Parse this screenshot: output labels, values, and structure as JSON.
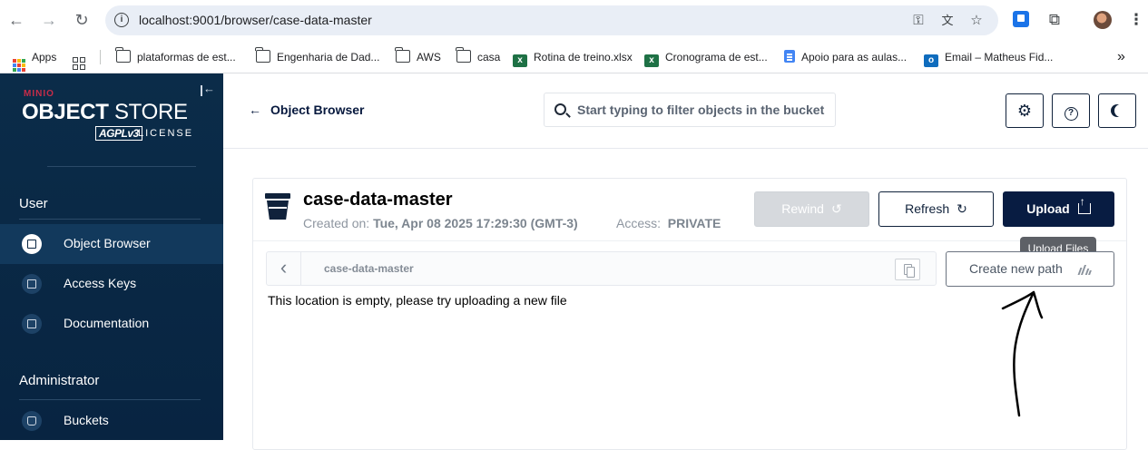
{
  "browser": {
    "url": "localhost:9001/browser/case-data-master",
    "bookmarks": [
      {
        "label": "Apps",
        "icon": "apps-grid-icon"
      },
      {
        "label": "",
        "icon": "tab-groups-icon"
      },
      {
        "label": "plataformas de est...",
        "icon": "folder-icon"
      },
      {
        "label": "Engenharia de Dad...",
        "icon": "folder-icon"
      },
      {
        "label": "AWS",
        "icon": "folder-icon"
      },
      {
        "label": "casa",
        "icon": "folder-icon"
      },
      {
        "label": "Rotina de treino.xlsx",
        "icon": "excel-icon"
      },
      {
        "label": "Cronograma de est...",
        "icon": "excel-icon"
      },
      {
        "label": "Apoio para as aulas...",
        "icon": "docs-icon"
      },
      {
        "label": "Email – Matheus Fid...",
        "icon": "outlook-icon"
      }
    ],
    "overflow_label": "»"
  },
  "sidebar": {
    "brand_small": "MINIO",
    "brand_title_bold": "OBJECT",
    "brand_title_thin": "STORE",
    "brand_badge": "AGPLv3",
    "brand_license": "LICENSE",
    "user_section": "User",
    "user_items": [
      {
        "label": "Object Browser",
        "active": true
      },
      {
        "label": "Access Keys",
        "active": false
      },
      {
        "label": "Documentation",
        "active": false
      }
    ],
    "admin_section": "Administrator",
    "admin_items": [
      {
        "label": "Buckets",
        "active": false
      }
    ]
  },
  "header": {
    "back_label": "Object Browser",
    "search_placeholder": "Start typing to filter objects in the bucket"
  },
  "bucket": {
    "name": "case-data-master",
    "created_label": "Created on:",
    "created_value": "Tue, Apr 08 2025 17:29:30 (GMT-3)",
    "access_label": "Access:",
    "access_value": "PRIVATE",
    "rewind_label": "Rewind",
    "refresh_label": "Refresh",
    "upload_label": "Upload",
    "upload_tooltip": "Upload Files",
    "breadcrumb": "case-data-master",
    "new_path_label": "Create new path",
    "empty_message": "This location is empty, please try uploading a new file"
  },
  "colors": {
    "sidebar_bg": "#082441",
    "primary": "#081c42",
    "accent_red": "#c72c48"
  }
}
